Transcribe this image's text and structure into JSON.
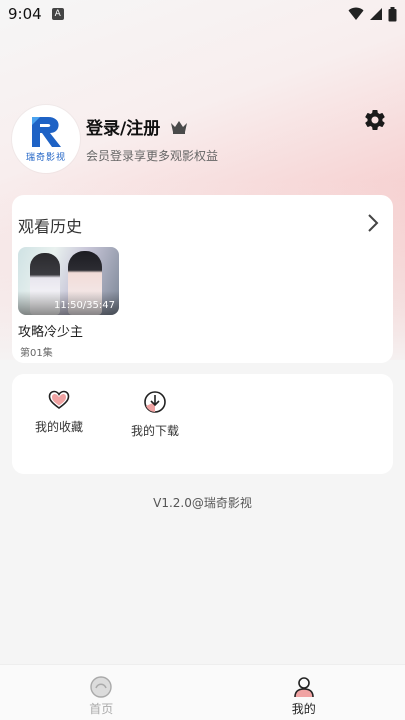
{
  "status_bar": {
    "time": "9:04",
    "notification_letter": "A"
  },
  "profile": {
    "avatar_text": "瑞奇影视",
    "login_title": "登录/注册",
    "member_tip": "会员登录享更多观影权益"
  },
  "history": {
    "title": "观看历史",
    "items": [
      {
        "progress": "11:50/35:47",
        "title": "攻略冷少主",
        "episode": "第01集"
      }
    ]
  },
  "actions": {
    "favorites_label": "我的收藏",
    "downloads_label": "我的下载"
  },
  "version_text": "V1.2.0@瑞奇影视",
  "bottom_nav": {
    "home_label": "首页",
    "mine_label": "我的",
    "active": "mine"
  },
  "colors": {
    "brand_blue": "#1e62c5",
    "accent_pink": "#f0a3a3",
    "heart_red": "#e05555"
  }
}
